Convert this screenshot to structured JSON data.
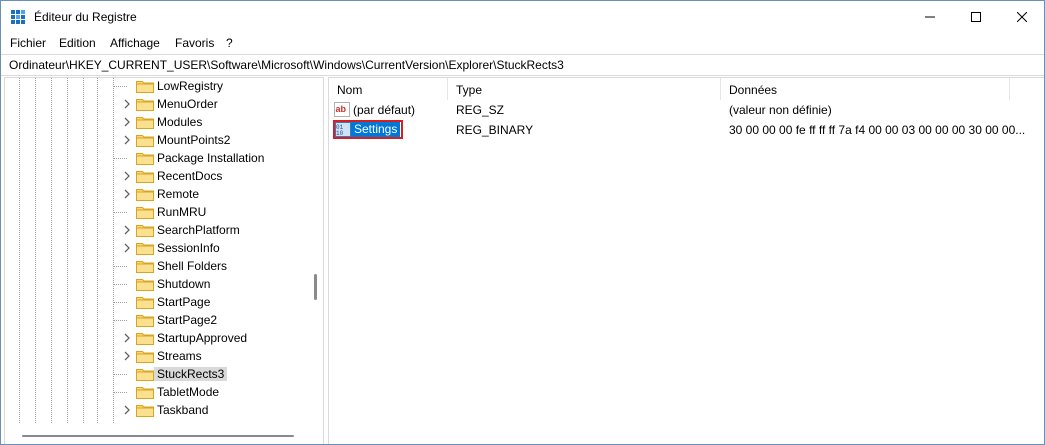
{
  "window": {
    "title": "Éditeur du Registre",
    "controls": {
      "minimize": "minimize",
      "maximize": "maximize",
      "close": "close"
    }
  },
  "menu": [
    "Fichier",
    "Edition",
    "Affichage",
    "Favoris",
    "?"
  ],
  "address": "Ordinateur\\HKEY_CURRENT_USER\\Software\\Microsoft\\Windows\\CurrentVersion\\Explorer\\StuckRects3",
  "tree": {
    "items": [
      {
        "label": "LowRegistry",
        "expandable": false
      },
      {
        "label": "MenuOrder",
        "expandable": true
      },
      {
        "label": "Modules",
        "expandable": true
      },
      {
        "label": "MountPoints2",
        "expandable": true
      },
      {
        "label": "Package Installation",
        "expandable": false
      },
      {
        "label": "RecentDocs",
        "expandable": true
      },
      {
        "label": "Remote",
        "expandable": true
      },
      {
        "label": "RunMRU",
        "expandable": false
      },
      {
        "label": "SearchPlatform",
        "expandable": true
      },
      {
        "label": "SessionInfo",
        "expandable": true
      },
      {
        "label": "Shell Folders",
        "expandable": false
      },
      {
        "label": "Shutdown",
        "expandable": false
      },
      {
        "label": "StartPage",
        "expandable": false
      },
      {
        "label": "StartPage2",
        "expandable": false
      },
      {
        "label": "StartupApproved",
        "expandable": true
      },
      {
        "label": "Streams",
        "expandable": true
      },
      {
        "label": "StuckRects3",
        "expandable": false,
        "selected": true
      },
      {
        "label": "TabletMode",
        "expandable": false
      },
      {
        "label": "Taskband",
        "expandable": true
      }
    ]
  },
  "list": {
    "headers": {
      "name": "Nom",
      "type": "Type",
      "data": "Données"
    },
    "rows": [
      {
        "name": "(par défaut)",
        "type": "REG_SZ",
        "data": "(valeur non définie)",
        "icon": "string-value-icon"
      },
      {
        "name": "Settings",
        "type": "REG_BINARY",
        "data": "30 00 00 00 fe ff ff ff 7a f4 00 00 03 00 00 00 30 00 00...",
        "icon": "binary-value-icon",
        "selected": true
      }
    ]
  },
  "colors": {
    "selection": "#0078d7",
    "highlight_box": "#d81f1f",
    "folder": "#f8d775"
  }
}
